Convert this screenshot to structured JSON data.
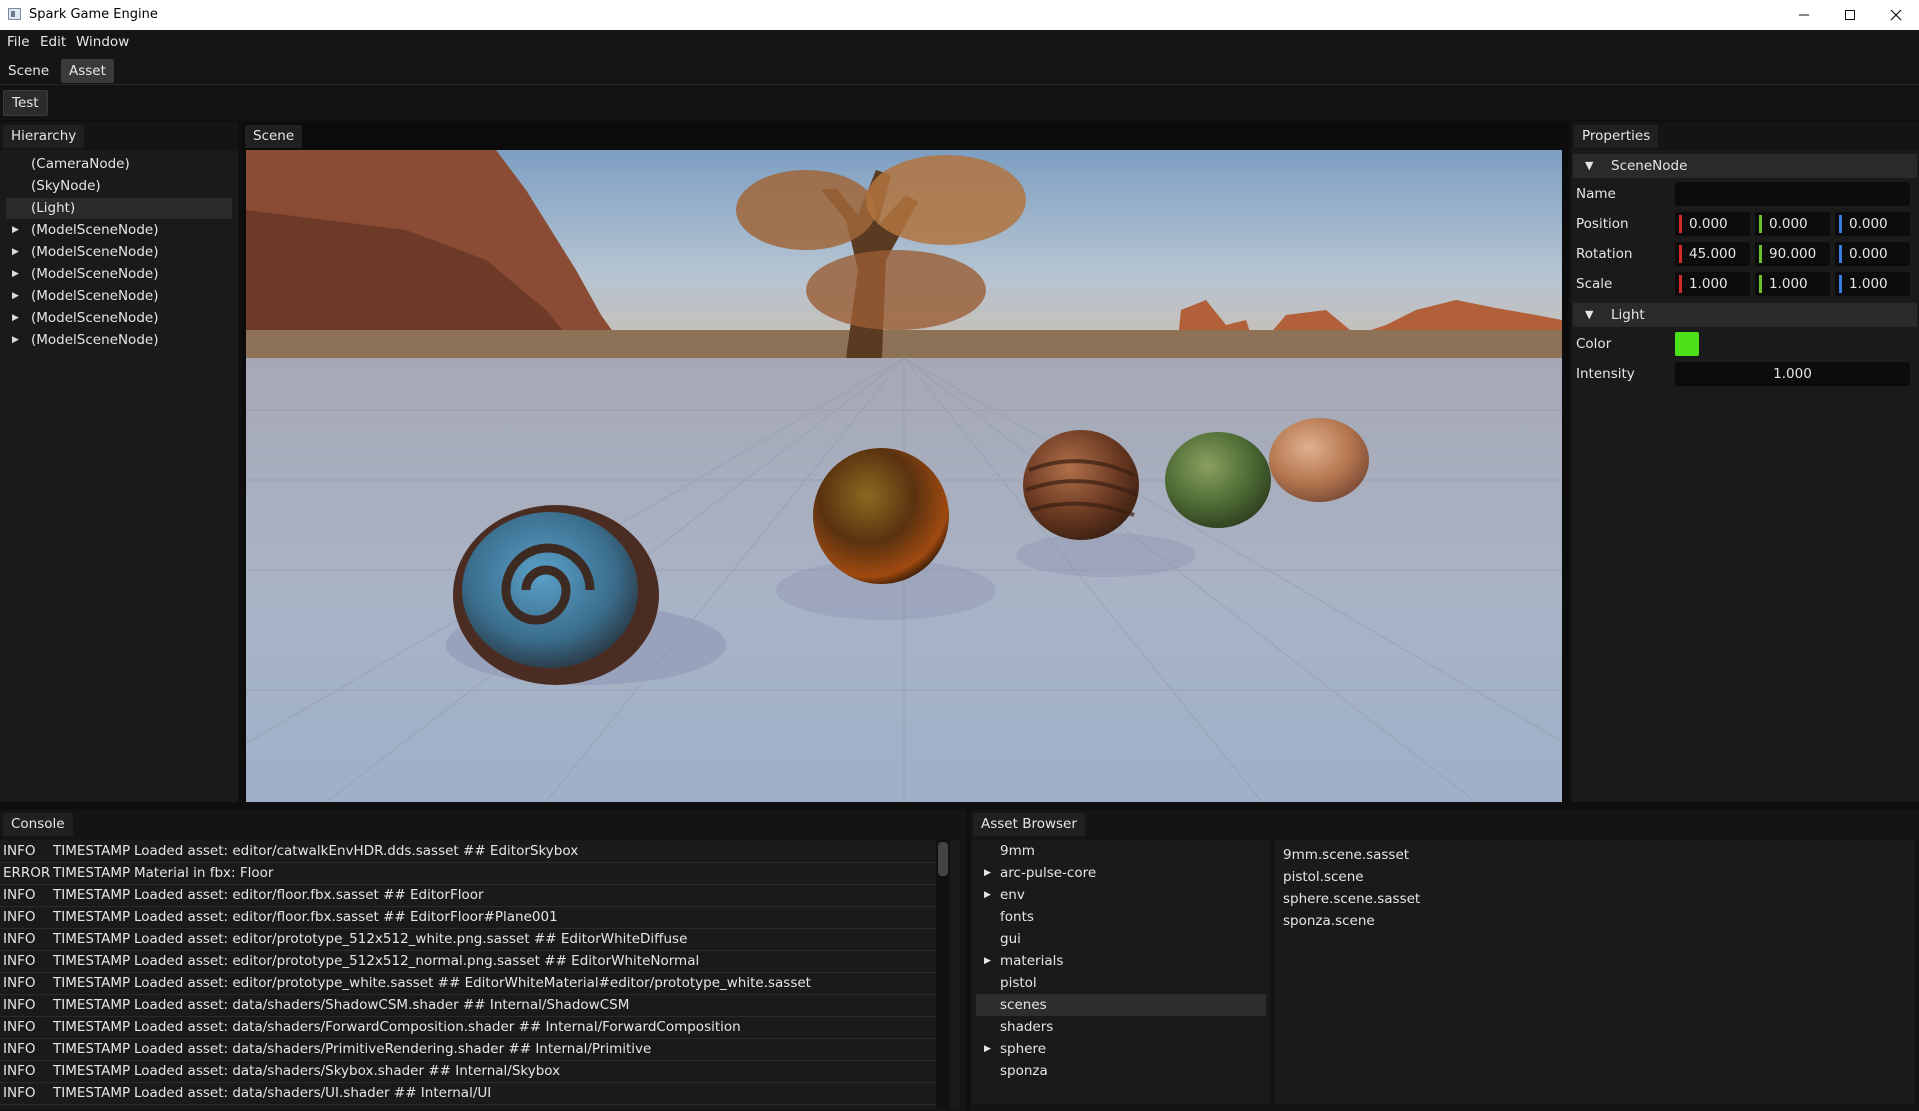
{
  "window": {
    "title": "Spark Game Engine"
  },
  "menu": [
    "File",
    "Edit",
    "Window"
  ],
  "tabs": [
    {
      "label": "Scene",
      "active": false
    },
    {
      "label": "Asset",
      "active": true
    }
  ],
  "toolbar": {
    "test_label": "Test"
  },
  "hierarchy": {
    "title": "Hierarchy",
    "items": [
      {
        "label": "(CameraNode)",
        "expandable": false,
        "selected": false
      },
      {
        "label": "(SkyNode)",
        "expandable": false,
        "selected": false
      },
      {
        "label": "(Light)",
        "expandable": false,
        "selected": true
      },
      {
        "label": "(ModelSceneNode)",
        "expandable": true,
        "selected": false
      },
      {
        "label": "(ModelSceneNode)",
        "expandable": true,
        "selected": false
      },
      {
        "label": "(ModelSceneNode)",
        "expandable": true,
        "selected": false
      },
      {
        "label": "(ModelSceneNode)",
        "expandable": true,
        "selected": false
      },
      {
        "label": "(ModelSceneNode)",
        "expandable": true,
        "selected": false
      },
      {
        "label": "(ModelSceneNode)",
        "expandable": true,
        "selected": false
      }
    ]
  },
  "scene": {
    "title": "Scene"
  },
  "properties": {
    "title": "Properties",
    "scene_node": {
      "header": "SceneNode",
      "name_label": "Name",
      "name_value": "",
      "position_label": "Position",
      "position": [
        "0.000",
        "0.000",
        "0.000"
      ],
      "rotation_label": "Rotation",
      "rotation": [
        "45.000",
        "90.000",
        "0.000"
      ],
      "scale_label": "Scale",
      "scale": [
        "1.000",
        "1.000",
        "1.000"
      ]
    },
    "light": {
      "header": "Light",
      "color_label": "Color",
      "color_value": "#4be01a",
      "intensity_label": "Intensity",
      "intensity": "1.000"
    },
    "axis_colors": [
      "#d42a2a",
      "#6abf2a",
      "#3a7be0"
    ]
  },
  "console": {
    "title": "Console",
    "rows": [
      {
        "level": "INFO",
        "ts": "TIMESTAMP",
        "msg": "Loaded asset: editor/catwalkEnvHDR.dds.sasset ## EditorSkybox"
      },
      {
        "level": "ERROR",
        "ts": "TIMESTAMP",
        "msg": "Material in fbx: Floor"
      },
      {
        "level": "INFO",
        "ts": "TIMESTAMP",
        "msg": "Loaded asset: editor/floor.fbx.sasset ## EditorFloor"
      },
      {
        "level": "INFO",
        "ts": "TIMESTAMP",
        "msg": "Loaded asset: editor/floor.fbx.sasset ## EditorFloor#Plane001"
      },
      {
        "level": "INFO",
        "ts": "TIMESTAMP",
        "msg": "Loaded asset: editor/prototype_512x512_white.png.sasset ## EditorWhiteDiffuse"
      },
      {
        "level": "INFO",
        "ts": "TIMESTAMP",
        "msg": "Loaded asset: editor/prototype_512x512_normal.png.sasset ## EditorWhiteNormal"
      },
      {
        "level": "INFO",
        "ts": "TIMESTAMP",
        "msg": "Loaded asset: editor/prototype_white.sasset ## EditorWhiteMaterial#editor/prototype_white.sasset"
      },
      {
        "level": "INFO",
        "ts": "TIMESTAMP",
        "msg": "Loaded asset: data/shaders/ShadowCSM.shader ## Internal/ShadowCSM"
      },
      {
        "level": "INFO",
        "ts": "TIMESTAMP",
        "msg": "Loaded asset: data/shaders/ForwardComposition.shader ## Internal/ForwardComposition"
      },
      {
        "level": "INFO",
        "ts": "TIMESTAMP",
        "msg": "Loaded asset: data/shaders/PrimitiveRendering.shader ## Internal/Primitive"
      },
      {
        "level": "INFO",
        "ts": "TIMESTAMP",
        "msg": "Loaded asset: data/shaders/Skybox.shader ## Internal/Skybox"
      },
      {
        "level": "INFO",
        "ts": "TIMESTAMP",
        "msg": "Loaded asset: data/shaders/UI.shader ## Internal/UI"
      }
    ]
  },
  "asset_browser": {
    "title": "Asset Browser",
    "tree": [
      {
        "label": "9mm",
        "expandable": false,
        "selected": false
      },
      {
        "label": "arc-pulse-core",
        "expandable": true,
        "selected": false
      },
      {
        "label": "env",
        "expandable": true,
        "selected": false
      },
      {
        "label": "fonts",
        "expandable": false,
        "selected": false
      },
      {
        "label": "gui",
        "expandable": false,
        "selected": false
      },
      {
        "label": "materials",
        "expandable": true,
        "selected": false
      },
      {
        "label": "pistol",
        "expandable": false,
        "selected": false
      },
      {
        "label": "scenes",
        "expandable": false,
        "selected": true
      },
      {
        "label": "shaders",
        "expandable": false,
        "selected": false
      },
      {
        "label": "sphere",
        "expandable": true,
        "selected": false
      },
      {
        "label": "sponza",
        "expandable": false,
        "selected": false
      }
    ],
    "files": [
      "9mm.scene.sasset",
      "pistol.scene",
      "sphere.scene.sasset",
      "sponza.scene"
    ]
  }
}
